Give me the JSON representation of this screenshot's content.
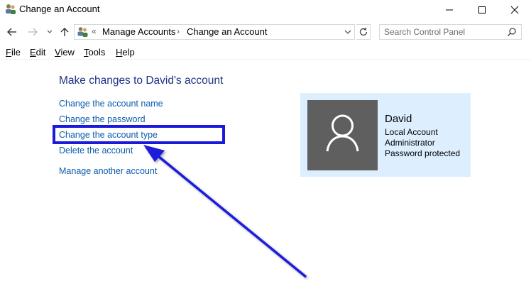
{
  "window": {
    "title": "Change an Account",
    "icon": "users-icon"
  },
  "navigation": {
    "back_icon": "back-arrow-icon",
    "forward_icon": "forward-arrow-icon",
    "recent_icon": "chevron-down-icon",
    "up_icon": "up-arrow-icon",
    "breadcrumb": [
      "Manage Accounts",
      "Change an Account"
    ],
    "overflow_marker": "«",
    "separator": "›",
    "refresh_icon": "refresh-icon",
    "search_placeholder": "Search Control Panel"
  },
  "menu": {
    "items": [
      {
        "label": "File",
        "key": "F",
        "rest": "ile"
      },
      {
        "label": "Edit",
        "key": "E",
        "rest": "dit"
      },
      {
        "label": "View",
        "key": "V",
        "rest": "iew"
      },
      {
        "label": "Tools",
        "key": "T",
        "rest": "ools"
      },
      {
        "label": "Help",
        "key": "H",
        "rest": "elp"
      }
    ]
  },
  "content": {
    "heading": "Make changes to David's account",
    "tasks": [
      "Change the account name",
      "Change the password",
      "Change the account type",
      "Delete the account"
    ],
    "other_task": "Manage another account",
    "highlighted_task_index": 2
  },
  "account": {
    "name": "David",
    "details": [
      "Local Account",
      "Administrator",
      "Password protected"
    ],
    "avatar_icon": "user-avatar-icon"
  },
  "colors": {
    "link": "#0b5cad",
    "heading": "#1e3287",
    "card_bg": "#ddeeff",
    "avatar_bg": "#5f5f5f",
    "annotation": "#1a1add"
  }
}
